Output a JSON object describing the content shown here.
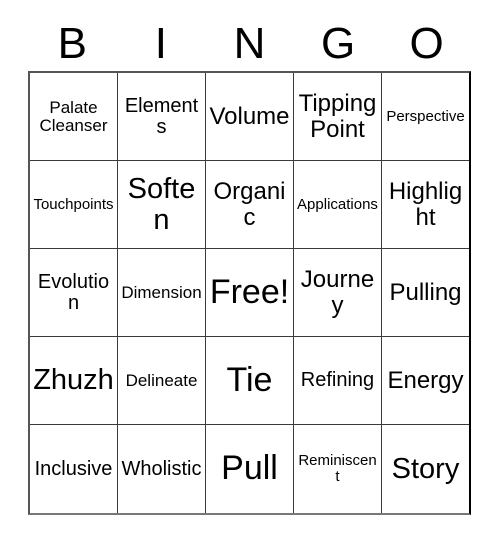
{
  "card": {
    "header_letters": [
      "B",
      "I",
      "N",
      "G",
      "O"
    ],
    "free_space_label": "Free!",
    "colors": {
      "background": "#ffffff",
      "text": "#000000",
      "gridline": "#3a3a3a",
      "outer_border": "#555555"
    },
    "rows": [
      [
        {
          "text": "Palate Cleanser",
          "size": "md"
        },
        {
          "text": "Elements",
          "size": "lg"
        },
        {
          "text": "Volume",
          "size": "xl"
        },
        {
          "text": "Tipping Point",
          "size": "xl"
        },
        {
          "text": "Perspective",
          "size": "sm"
        }
      ],
      [
        {
          "text": "Touchpoints",
          "size": "sm"
        },
        {
          "text": "Soften",
          "size": "xxl"
        },
        {
          "text": "Organic",
          "size": "xl"
        },
        {
          "text": "Applications",
          "size": "sm"
        },
        {
          "text": "Highlight",
          "size": "xl"
        }
      ],
      [
        {
          "text": "Evolution",
          "size": "lg"
        },
        {
          "text": "Dimension",
          "size": "md"
        },
        {
          "text": "Free!",
          "size": "huge"
        },
        {
          "text": "Journey",
          "size": "xl"
        },
        {
          "text": "Pulling",
          "size": "xl"
        }
      ],
      [
        {
          "text": "Zhuzh",
          "size": "xxl"
        },
        {
          "text": "Delineate",
          "size": "md"
        },
        {
          "text": "Tie",
          "size": "huge"
        },
        {
          "text": "Refining",
          "size": "lg"
        },
        {
          "text": "Energy",
          "size": "xl"
        }
      ],
      [
        {
          "text": "Inclusive",
          "size": "lg"
        },
        {
          "text": "Wholistic",
          "size": "lg"
        },
        {
          "text": "Pull",
          "size": "huge"
        },
        {
          "text": "Reminiscent",
          "size": "sm"
        },
        {
          "text": "Story",
          "size": "xxl"
        }
      ]
    ]
  }
}
